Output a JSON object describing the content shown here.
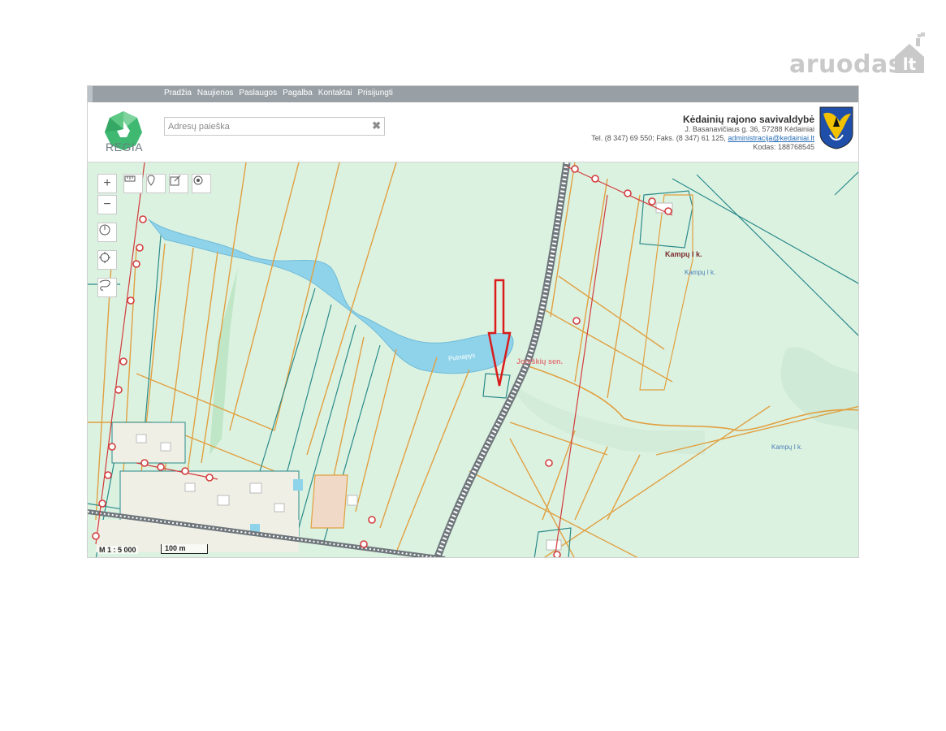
{
  "watermark": {
    "brand": "aruodas",
    "domain_suffix": "lt"
  },
  "nav": {
    "items": [
      "Pradžia",
      "Naujienos",
      "Paslaugos",
      "Pagalba",
      "Kontaktai",
      "Prisijungti"
    ]
  },
  "header": {
    "logo_text": "REGIA",
    "search_placeholder": "Adresų paieška",
    "clear_symbol": "✖",
    "municipality": {
      "name": "Kėdainių rajono savivaldybė",
      "address": "J. Basanavičiaus g. 36, 57288 Kėdainiai",
      "contact_prefix": "Tel. (8 347) 69 550; Faks. (8 347) 61 125,",
      "email": "administracija@kedainiai.lt",
      "code": "Kodas: 188768545"
    }
  },
  "toolbar": {
    "zoom_in": "+",
    "zoom_out": "−",
    "tools": [
      "ruler-icon",
      "marker-icon",
      "edit-icon",
      "locate-icon",
      "power-icon",
      "crosshair-icon",
      "lasso-icon"
    ]
  },
  "map": {
    "labels": {
      "village_1": "Kampų I k.",
      "village_1_small": "Kampų I k.",
      "village_2": "Kampų I k.",
      "water_name": "Putnapys",
      "red_label": "Joniškių sen."
    },
    "scale_text": "M 1 : 5 000",
    "scale_bar": "100 m",
    "colors": {
      "background": "#dcf2e1",
      "water": "#8fd3ea",
      "parcel_orange": "#e0a041",
      "parcel_teal": "#2a8a8a",
      "road": "#8a939a",
      "utility_red": "#d23c3c",
      "arrow": "#d91c1c"
    }
  }
}
